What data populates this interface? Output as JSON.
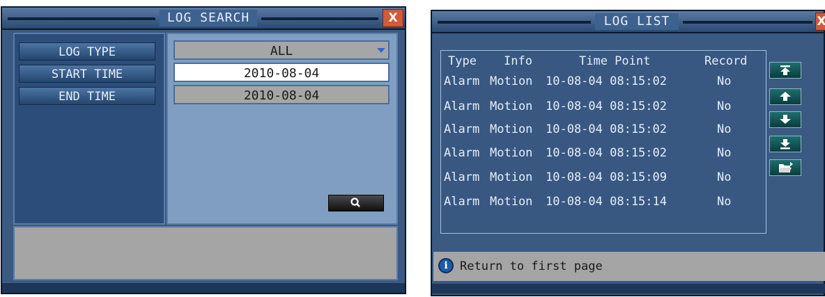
{
  "log_search": {
    "title": "LOG SEARCH",
    "close_label": "X",
    "labels": {
      "log_type": "LOG TYPE",
      "start_time": "START TIME",
      "end_time": "END TIME"
    },
    "values": {
      "log_type": "ALL",
      "start_time": "2010-08-04",
      "end_time": "2010-08-04"
    },
    "search_icon": "search-icon"
  },
  "log_list": {
    "title": "LOG LIST",
    "close_label": "X",
    "columns": [
      "Type",
      "Info",
      "Time Point",
      "Record"
    ],
    "rows": [
      {
        "type": "Alarm",
        "info": "Motion",
        "time": "10-08-04 08:15:02",
        "record": "No"
      },
      {
        "type": "Alarm",
        "info": "Motion",
        "time": "10-08-04 08:15:02",
        "record": "No"
      },
      {
        "type": "Alarm",
        "info": "Motion",
        "time": "10-08-04 08:15:02",
        "record": "No"
      },
      {
        "type": "Alarm",
        "info": "Motion",
        "time": "10-08-04 08:15:02",
        "record": "No"
      },
      {
        "type": "Alarm",
        "info": "Motion",
        "time": "10-08-04 08:15:09",
        "record": "No"
      },
      {
        "type": "Alarm",
        "info": "Motion",
        "time": "10-08-04 08:15:14",
        "record": "No"
      }
    ],
    "nav_icons": [
      "first-page-icon",
      "previous-page-icon",
      "next-page-icon",
      "last-page-icon",
      "backup-folder-icon"
    ],
    "hint": "Return to first page"
  },
  "colors": {
    "panel_blue": "#3a5a82",
    "field_white": "#ffffff",
    "field_gray": "#a6a6a6",
    "close_red": "#d05a3a",
    "nav_teal": "#0f5454"
  }
}
